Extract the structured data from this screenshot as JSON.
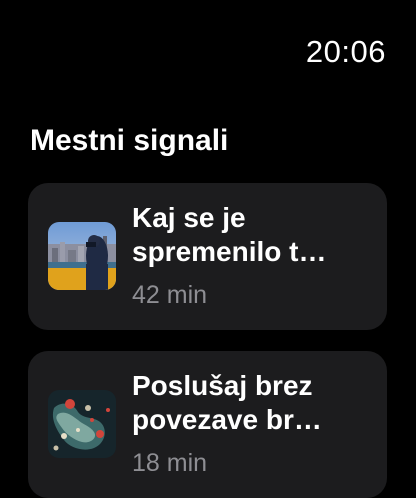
{
  "status": {
    "time": "20:06"
  },
  "section": {
    "title": "Mestni signali"
  },
  "episodes": [
    {
      "title_line1": "Kaj se je",
      "title_line2": "spremenilo t…",
      "duration": "42 min",
      "artwork": "city-skyline-photographer-artwork"
    },
    {
      "title_line1": "Poslušaj brez",
      "title_line2": "povezave br…",
      "duration": "18 min",
      "artwork": "abstract-map-splatter-artwork"
    }
  ],
  "colors": {
    "background": "#000000",
    "card": "#1c1c1e",
    "secondary_text": "#8e8e93"
  }
}
